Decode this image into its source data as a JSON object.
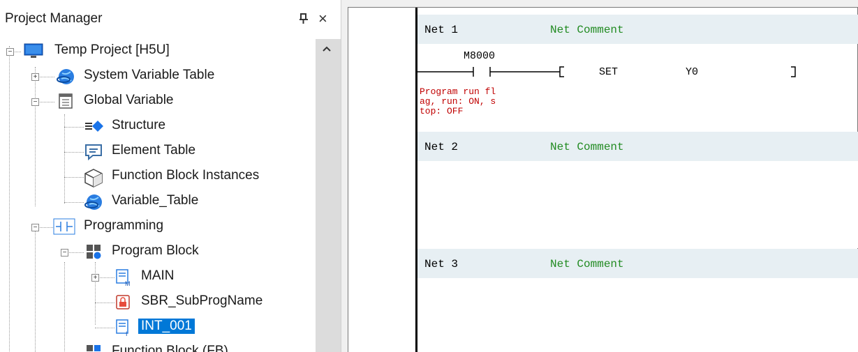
{
  "panel": {
    "title": "Project Manager",
    "pin_glyph": "4",
    "close_glyph": "×"
  },
  "tree": {
    "items": [
      {
        "label": "Temp Project [H5U]",
        "icon": "computer-icon"
      },
      {
        "label": "System Variable Table",
        "icon": "globe-icon"
      },
      {
        "label": "Global Variable",
        "icon": "document-list-icon"
      },
      {
        "label": "Structure",
        "icon": "structure-icon"
      },
      {
        "label": "Element Table",
        "icon": "comment-icon"
      },
      {
        "label": "Function Block Instances",
        "icon": "cube-icon"
      },
      {
        "label": "Variable_Table",
        "icon": "globe-icon"
      },
      {
        "label": "Programming",
        "icon": "ladder-contact-icon"
      },
      {
        "label": "Program Block",
        "icon": "blocks-icon"
      },
      {
        "label": "MAIN",
        "icon": "main-program-icon"
      },
      {
        "label": "SBR_SubProgName",
        "icon": "lock-icon"
      },
      {
        "label": "INT_001",
        "icon": "interrupt-program-icon"
      },
      {
        "label": "Function Block (FB)",
        "icon": "blocks-icon"
      }
    ],
    "selected": "INT_001"
  },
  "ladder": {
    "nets": [
      {
        "name": "Net 1",
        "comment": "Net Comment"
      },
      {
        "name": "Net 2",
        "comment": "Net Comment"
      },
      {
        "name": "Net 3",
        "comment": "Net Comment"
      }
    ],
    "contact": {
      "address": "M8000",
      "comment_lines": [
        "Program run fl",
        "ag, run: ON, s",
        "top: OFF"
      ]
    },
    "instruction": {
      "mnemonic": "SET",
      "operand": "Y0"
    }
  },
  "colors": {
    "net_header_bg": "#e7eff3",
    "comment_green": "#228b22",
    "comment_red": "#c00000",
    "selection": "#0078d7"
  }
}
